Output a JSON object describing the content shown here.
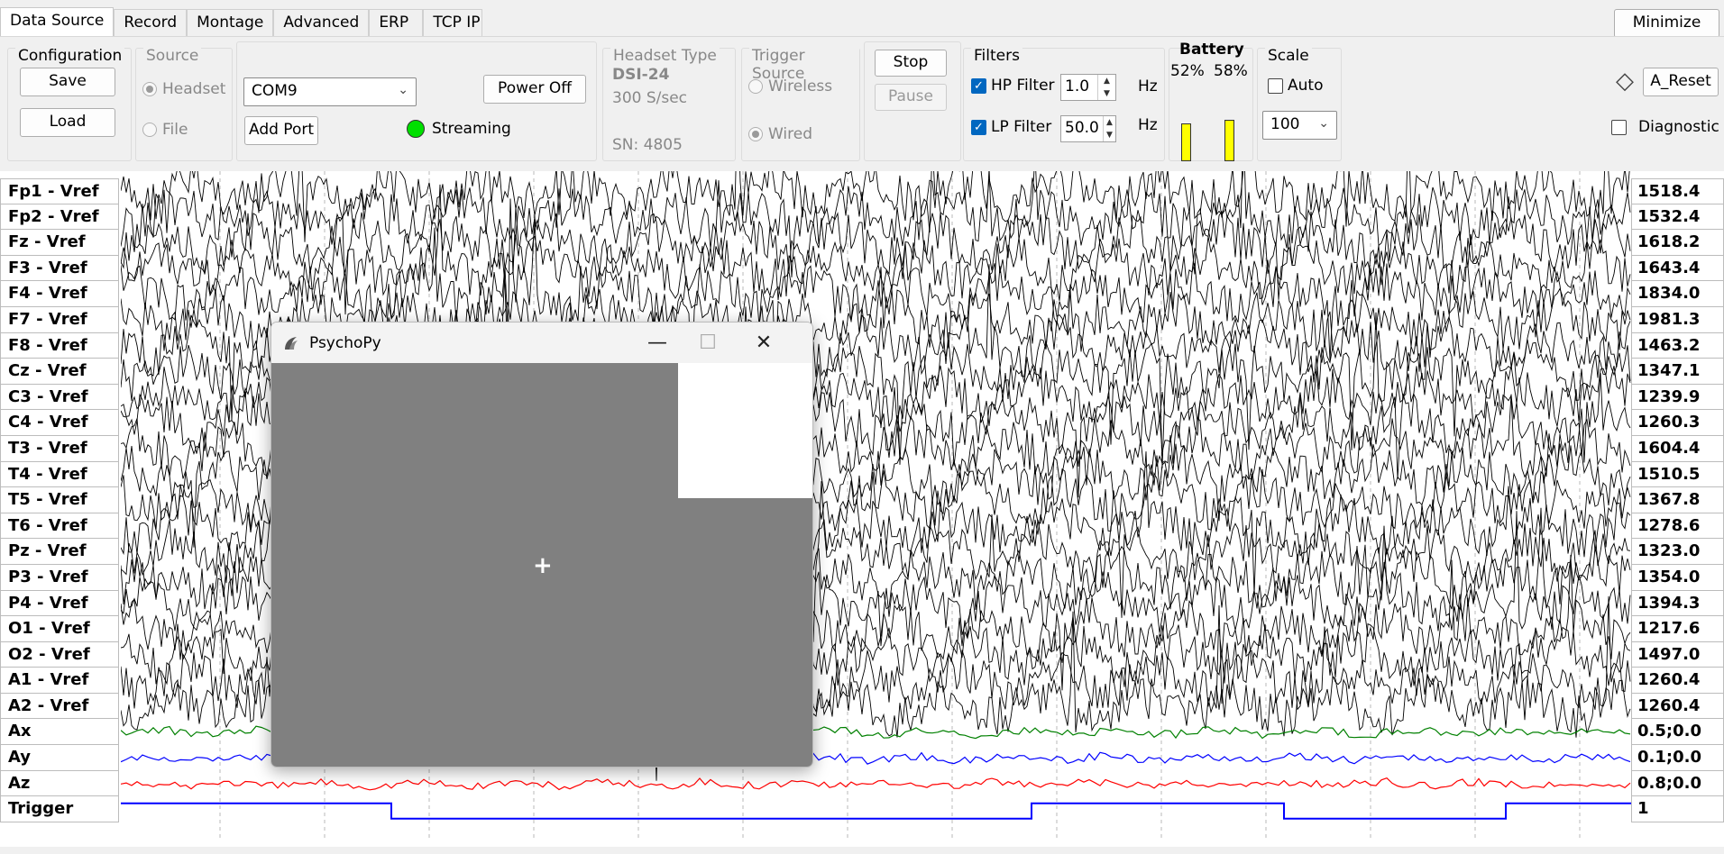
{
  "tabs": [
    "Data Source",
    "Record",
    "Montage",
    "Advanced",
    "ERP",
    "TCP IP"
  ],
  "configuration": {
    "title": "Configuration",
    "save": "Save",
    "load": "Load"
  },
  "source": {
    "title": "Source",
    "headset": "Headset",
    "file": "File",
    "selected": "Headset"
  },
  "port": {
    "selected": "COM9",
    "power_off": "Power Off",
    "add_port": "Add Port",
    "status": "Streaming",
    "status_color": "#00e000"
  },
  "headset": {
    "title": "Headset Type",
    "model": "DSI-24",
    "rate": "300 S/sec",
    "serial": "SN: 4805"
  },
  "trigger": {
    "title": "Trigger Source",
    "wireless": "Wireless",
    "wired": "Wired",
    "selected": "Wired"
  },
  "run": {
    "stop": "Stop",
    "pause": "Pause"
  },
  "filters": {
    "title": "Filters",
    "hp_label": "HP Filter",
    "hp_value": "1.0",
    "lp_label": "LP Filter",
    "lp_value": "50.0",
    "unit": "Hz",
    "hp_enabled": true,
    "lp_enabled": true
  },
  "battery": {
    "title": "Battery",
    "left": "52%",
    "right": "58%",
    "left_level": 0.52,
    "right_level": 0.58,
    "color": "#ffff00"
  },
  "scale": {
    "title": "Scale",
    "auto": "Auto",
    "value": "100"
  },
  "side": {
    "minimize": "Minimize",
    "a_reset": "A_Reset",
    "diagnostic": "Diagnostic"
  },
  "channels": [
    {
      "name": "Fp1 - Vref",
      "value": "1518.4"
    },
    {
      "name": "Fp2 - Vref",
      "value": "1532.4"
    },
    {
      "name": "Fz - Vref",
      "value": "1618.2"
    },
    {
      "name": "F3 - Vref",
      "value": "1643.4"
    },
    {
      "name": "F4 - Vref",
      "value": "1834.0"
    },
    {
      "name": "F7 - Vref",
      "value": "1981.3"
    },
    {
      "name": "F8 - Vref",
      "value": "1463.2"
    },
    {
      "name": "Cz - Vref",
      "value": "1347.1"
    },
    {
      "name": "C3 - Vref",
      "value": "1239.9"
    },
    {
      "name": "C4 - Vref",
      "value": "1260.3"
    },
    {
      "name": "T3 - Vref",
      "value": "1604.4"
    },
    {
      "name": "T4 - Vref",
      "value": "1510.5"
    },
    {
      "name": "T5 - Vref",
      "value": "1367.8"
    },
    {
      "name": "T6 - Vref",
      "value": "1278.6"
    },
    {
      "name": "Pz - Vref",
      "value": "1323.0"
    },
    {
      "name": "P3 - Vref",
      "value": "1354.0"
    },
    {
      "name": "P4 - Vref",
      "value": "1394.3"
    },
    {
      "name": "O1 - Vref",
      "value": "1217.6"
    },
    {
      "name": "O2 - Vref",
      "value": "1497.0"
    },
    {
      "name": "A1 - Vref",
      "value": "1260.4"
    },
    {
      "name": "A2 - Vref",
      "value": "1260.4"
    },
    {
      "name": "Ax",
      "value": "0.5;0.0",
      "color": "#008000"
    },
    {
      "name": "Ay",
      "value": "0.1;0.0",
      "color": "#0000ff"
    },
    {
      "name": "Az",
      "value": "0.8;0.0",
      "color": "#ff0000"
    },
    {
      "name": "Trigger",
      "value": "1",
      "color": "#0000ff"
    }
  ],
  "psychopy": {
    "title": "PsychoPy",
    "bg_color": "#808080"
  }
}
